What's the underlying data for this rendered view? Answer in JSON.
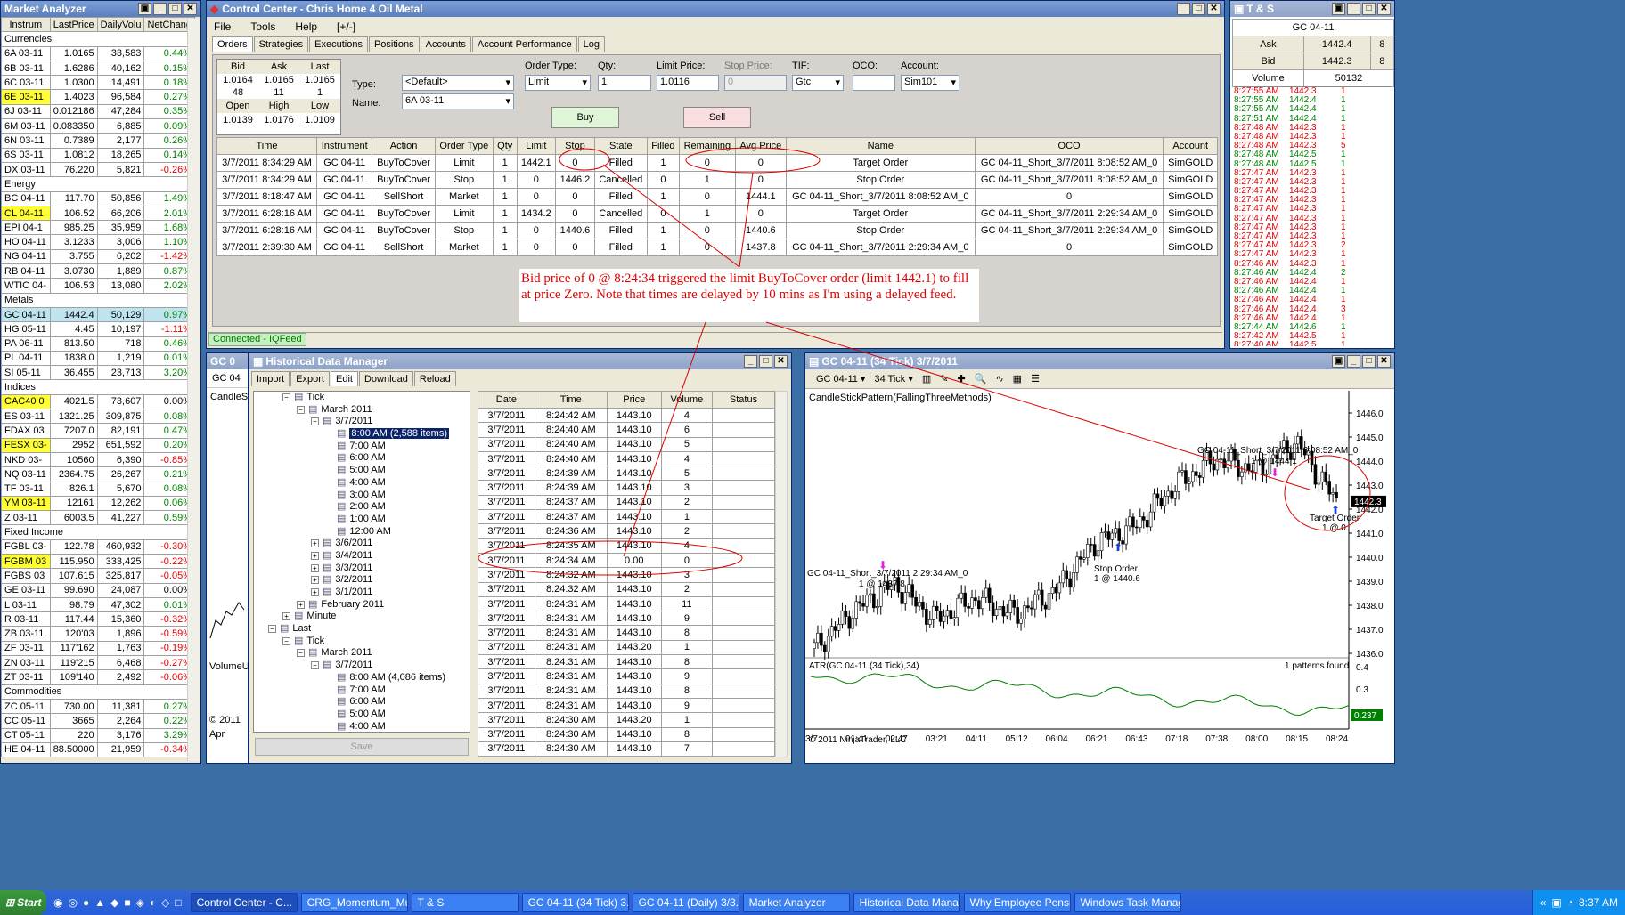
{
  "market_analyzer": {
    "title": "Market Analyzer",
    "columns": [
      "Instrum",
      "LastPrice",
      "DailyVolu",
      "NetChang"
    ],
    "rows": [
      {
        "section": "Currencies"
      },
      {
        "i": "6A 03-11",
        "p": "1.0165",
        "v": "33,583",
        "c": "0.44%",
        "d": "pos"
      },
      {
        "i": "6B 03-11",
        "p": "1.6286",
        "v": "40,162",
        "c": "0.15%",
        "d": "pos"
      },
      {
        "i": "6C 03-11",
        "p": "1.0300",
        "v": "14,491",
        "c": "0.18%",
        "d": "pos"
      },
      {
        "i": "6E 03-11",
        "p": "1.4023",
        "v": "96,584",
        "c": "0.27%",
        "d": "pos",
        "hl": "y"
      },
      {
        "i": "6J 03-11",
        "p": "0.012186",
        "v": "47,284",
        "c": "0.35%",
        "d": "pos"
      },
      {
        "i": "6M 03-11",
        "p": "0.083350",
        "v": "6,885",
        "c": "0.09%",
        "d": "pos"
      },
      {
        "i": "6N 03-11",
        "p": "0.7389",
        "v": "2,177",
        "c": "0.26%",
        "d": "pos"
      },
      {
        "i": "6S 03-11",
        "p": "1.0812",
        "v": "18,265",
        "c": "0.14%",
        "d": "pos"
      },
      {
        "i": "DX 03-11",
        "p": "76.220",
        "v": "5,821",
        "c": "-0.26%",
        "d": "neg"
      },
      {
        "section": "Energy"
      },
      {
        "i": "BC 04-11",
        "p": "117.70",
        "v": "50,856",
        "c": "1.49%",
        "d": "pos"
      },
      {
        "i": "CL 04-11",
        "p": "106.52",
        "v": "66,206",
        "c": "2.01%",
        "d": "pos",
        "hl": "y"
      },
      {
        "i": "EPI 04-1",
        "p": "985.25",
        "v": "35,959",
        "c": "1.68%",
        "d": "pos"
      },
      {
        "i": "HO 04-11",
        "p": "3.1233",
        "v": "3,006",
        "c": "1.10%",
        "d": "pos"
      },
      {
        "i": "NG 04-11",
        "p": "3.755",
        "v": "6,202",
        "c": "-1.42%",
        "d": "neg"
      },
      {
        "i": "RB 04-11",
        "p": "3.0730",
        "v": "1,889",
        "c": "0.87%",
        "d": "pos"
      },
      {
        "i": "WTIC 04-",
        "p": "106.53",
        "v": "13,080",
        "c": "2.02%",
        "d": "pos"
      },
      {
        "section": "Metals"
      },
      {
        "i": "GC 04-11",
        "p": "1442.4",
        "v": "50,129",
        "c": "0.97%",
        "d": "pos",
        "hl": "b"
      },
      {
        "i": "HG 05-11",
        "p": "4.45",
        "v": "10,197",
        "c": "-1.11%",
        "d": "neg"
      },
      {
        "i": "PA 06-11",
        "p": "813.50",
        "v": "718",
        "c": "0.46%",
        "d": "pos"
      },
      {
        "i": "PL 04-11",
        "p": "1838.0",
        "v": "1,219",
        "c": "0.01%",
        "d": "pos"
      },
      {
        "i": "SI 05-11",
        "p": "36.455",
        "v": "23,713",
        "c": "3.20%",
        "d": "pos"
      },
      {
        "section": "Indices"
      },
      {
        "i": "CAC40 0",
        "p": "4021.5",
        "v": "73,607",
        "c": "0.00%",
        "d": "",
        "hl": "y"
      },
      {
        "i": "ES 03-11",
        "p": "1321.25",
        "v": "309,875",
        "c": "0.08%",
        "d": "pos"
      },
      {
        "i": "FDAX 03",
        "p": "7207.0",
        "v": "82,191",
        "c": "0.47%",
        "d": "pos"
      },
      {
        "i": "FESX 03-",
        "p": "2952",
        "v": "651,592",
        "c": "0.20%",
        "d": "pos",
        "hl": "y"
      },
      {
        "i": "NKD 03-",
        "p": "10560",
        "v": "6,390",
        "c": "-0.85%",
        "d": "neg"
      },
      {
        "i": "NQ 03-11",
        "p": "2364.75",
        "v": "26,267",
        "c": "0.21%",
        "d": "pos"
      },
      {
        "i": "TF 03-11",
        "p": "826.1",
        "v": "5,670",
        "c": "0.08%",
        "d": "pos"
      },
      {
        "i": "YM 03-11",
        "p": "12161",
        "v": "12,262",
        "c": "0.06%",
        "d": "pos",
        "hl": "y"
      },
      {
        "i": "Z 03-11",
        "p": "6003.5",
        "v": "41,227",
        "c": "0.59%",
        "d": "pos"
      },
      {
        "section": "Fixed Income"
      },
      {
        "i": "FGBL 03-",
        "p": "122.78",
        "v": "460,932",
        "c": "-0.30%",
        "d": "neg"
      },
      {
        "i": "FGBM 03",
        "p": "115.950",
        "v": "333,425",
        "c": "-0.22%",
        "d": "neg",
        "hl": "y"
      },
      {
        "i": "FGBS 03",
        "p": "107.615",
        "v": "325,817",
        "c": "-0.05%",
        "d": "neg"
      },
      {
        "i": "GE 03-11",
        "p": "99.690",
        "v": "24,087",
        "c": "0.00%",
        "d": ""
      },
      {
        "i": "L 03-11",
        "p": "98.79",
        "v": "47,302",
        "c": "0.01%",
        "d": "pos"
      },
      {
        "i": "R 03-11",
        "p": "117.44",
        "v": "15,360",
        "c": "-0.32%",
        "d": "neg"
      },
      {
        "i": "ZB 03-11",
        "p": "120'03",
        "v": "1,896",
        "c": "-0.59%",
        "d": "neg"
      },
      {
        "i": "ZF 03-11",
        "p": "117'162",
        "v": "1,763",
        "c": "-0.19%",
        "d": "neg"
      },
      {
        "i": "ZN 03-11",
        "p": "119'215",
        "v": "6,468",
        "c": "-0.27%",
        "d": "neg"
      },
      {
        "i": "ZT 03-11",
        "p": "109'140",
        "v": "2,492",
        "c": "-0.06%",
        "d": "neg"
      },
      {
        "section": "Commodities"
      },
      {
        "i": "ZC 05-11",
        "p": "730.00",
        "v": "11,381",
        "c": "0.27%",
        "d": "pos"
      },
      {
        "i": "CC 05-11",
        "p": "3665",
        "v": "2,264",
        "c": "0.22%",
        "d": "pos"
      },
      {
        "i": "CT 05-11",
        "p": "220",
        "v": "3,176",
        "c": "3.29%",
        "d": "pos"
      },
      {
        "i": "HE 04-11",
        "p": "88.50000",
        "v": "21,959",
        "c": "-0.34%",
        "d": "neg"
      }
    ]
  },
  "control_center": {
    "title": "Control Center - Chris Home 4 Oil Metal",
    "menu": [
      "File",
      "Tools",
      "Help",
      "[+/-]"
    ],
    "tabs": [
      "Orders",
      "Strategies",
      "Executions",
      "Positions",
      "Accounts",
      "Account Performance",
      "Log"
    ],
    "quote": {
      "bid_h": "Bid",
      "ask_h": "Ask",
      "last_h": "Last",
      "bid": "1.0164",
      "ask": "1.0165",
      "last": "1.0165",
      "bid_sz": "48",
      "ask_sz": "11",
      "last_sz": "1",
      "open_h": "Open",
      "high_h": "High",
      "low_h": "Low",
      "open": "1.0139",
      "high": "1.0176",
      "low": "1.0109"
    },
    "form": {
      "type_label": "Type:",
      "type": "<Default>",
      "name_label": "Name:",
      "name": "6A 03-11",
      "order_type_label": "Order Type:",
      "order_type": "Limit",
      "qty_label": "Qty:",
      "qty": "1",
      "limit_label": "Limit Price:",
      "limit": "1.0116",
      "stop_label": "Stop Price:",
      "stop": "0",
      "tif_label": "TIF:",
      "tif": "Gtc",
      "oco_label": "OCO:",
      "oco": "",
      "account_label": "Account:",
      "account": "Sim101",
      "buy": "Buy",
      "sell": "Sell"
    },
    "orders_columns": [
      "Time",
      "Instrument",
      "Action",
      "Order Type",
      "Qty",
      "Limit",
      "Stop",
      "State",
      "Filled",
      "Remaining",
      "Avg Price",
      "Name",
      "OCO",
      "Account"
    ],
    "orders": [
      [
        "3/7/2011 8:34:29 AM",
        "GC 04-11",
        "BuyToCover",
        "Limit",
        "1",
        "1442.1",
        "0",
        "Filled",
        "1",
        "0",
        "0",
        "Target Order",
        "GC 04-11_Short_3/7/2011 8:08:52 AM_0",
        "SimGOLD"
      ],
      [
        "3/7/2011 8:34:29 AM",
        "GC 04-11",
        "BuyToCover",
        "Stop",
        "1",
        "0",
        "1446.2",
        "Cancelled",
        "0",
        "1",
        "0",
        "Stop Order",
        "GC 04-11_Short_3/7/2011 8:08:52 AM_0",
        "SimGOLD"
      ],
      [
        "3/7/2011 8:18:47 AM",
        "GC 04-11",
        "SellShort",
        "Market",
        "1",
        "0",
        "0",
        "Filled",
        "1",
        "0",
        "1444.1",
        "GC 04-11_Short_3/7/2011 8:08:52 AM_0",
        "0",
        "SimGOLD"
      ],
      [
        "3/7/2011 6:28:16 AM",
        "GC 04-11",
        "BuyToCover",
        "Limit",
        "1",
        "1434.2",
        "0",
        "Cancelled",
        "0",
        "1",
        "0",
        "Target Order",
        "GC 04-11_Short_3/7/2011 2:29:34 AM_0",
        "SimGOLD"
      ],
      [
        "3/7/2011 6:28:16 AM",
        "GC 04-11",
        "BuyToCover",
        "Stop",
        "1",
        "0",
        "1440.6",
        "Filled",
        "1",
        "0",
        "1440.6",
        "Stop Order",
        "GC 04-11_Short_3/7/2011 2:29:34 AM_0",
        "SimGOLD"
      ],
      [
        "3/7/2011 2:39:30 AM",
        "GC 04-11",
        "SellShort",
        "Market",
        "1",
        "0",
        "0",
        "Filled",
        "1",
        "0",
        "1437.8",
        "GC 04-11_Short_3/7/2011 2:29:34 AM_0",
        "0",
        "SimGOLD"
      ]
    ],
    "annotation": "Bid price of 0 @ 8:24:34 triggered the limit BuyToCover order (limit 1442.1) to fill at price Zero.  Note that times are delayed by 10 mins as I'm using a delayed feed.",
    "status": "Connected - IQFeed"
  },
  "ts": {
    "title": "T & S",
    "instrument": "GC 04-11",
    "ask_label": "Ask",
    "ask": "1442.4",
    "ask_sz": "8",
    "bid_label": "Bid",
    "bid": "1442.3",
    "bid_sz": "8",
    "volume_label": "Volume",
    "volume": "50132",
    "rows": [
      [
        "8:27:55 AM",
        "1442.3",
        "1",
        "r"
      ],
      [
        "8:27:55 AM",
        "1442.4",
        "1",
        "g"
      ],
      [
        "8:27:55 AM",
        "1442.4",
        "1",
        "g"
      ],
      [
        "8:27:51 AM",
        "1442.4",
        "1",
        "g"
      ],
      [
        "8:27:48 AM",
        "1442.3",
        "1",
        "r"
      ],
      [
        "8:27:48 AM",
        "1442.3",
        "1",
        "r"
      ],
      [
        "8:27:48 AM",
        "1442.3",
        "5",
        "r"
      ],
      [
        "8:27:48 AM",
        "1442.5",
        "1",
        "g"
      ],
      [
        "8:27:48 AM",
        "1442.5",
        "1",
        "g"
      ],
      [
        "8:27:47 AM",
        "1442.3",
        "1",
        "r"
      ],
      [
        "8:27:47 AM",
        "1442.3",
        "1",
        "r"
      ],
      [
        "8:27:47 AM",
        "1442.3",
        "1",
        "r"
      ],
      [
        "8:27:47 AM",
        "1442.3",
        "1",
        "r"
      ],
      [
        "8:27:47 AM",
        "1442.3",
        "1",
        "r"
      ],
      [
        "8:27:47 AM",
        "1442.3",
        "1",
        "r"
      ],
      [
        "8:27:47 AM",
        "1442.3",
        "1",
        "r"
      ],
      [
        "8:27:47 AM",
        "1442.3",
        "1",
        "r"
      ],
      [
        "8:27:47 AM",
        "1442.3",
        "2",
        "r"
      ],
      [
        "8:27:47 AM",
        "1442.3",
        "1",
        "r"
      ],
      [
        "8:27:46 AM",
        "1442.3",
        "1",
        "r"
      ],
      [
        "8:27:46 AM",
        "1442.4",
        "2",
        "g"
      ],
      [
        "8:27:46 AM",
        "1442.4",
        "1",
        "r"
      ],
      [
        "8:27:46 AM",
        "1442.4",
        "1",
        "g"
      ],
      [
        "8:27:46 AM",
        "1442.4",
        "1",
        "r"
      ],
      [
        "8:27:46 AM",
        "1442.4",
        "3",
        "r"
      ],
      [
        "8:27:46 AM",
        "1442.4",
        "1",
        "r"
      ],
      [
        "8:27:44 AM",
        "1442.6",
        "1",
        "g"
      ],
      [
        "8:27:42 AM",
        "1442.5",
        "1",
        "r"
      ],
      [
        "8:27:40 AM",
        "1442.5",
        "1",
        "r"
      ]
    ]
  },
  "hdm": {
    "title": "Historical Data Manager",
    "behind_title": "GC 0",
    "behind_tab": "GC 04",
    "behind_label1": "CandleSt",
    "behind_label2": "VolumeU",
    "behind_label3": "Apr",
    "behind_label4": "© 2011",
    "tabs": [
      "Import",
      "Export",
      "Edit",
      "Download",
      "Reload"
    ],
    "tree": [
      {
        "d": 2,
        "t": "Tick",
        "b": "−"
      },
      {
        "d": 3,
        "t": "March 2011",
        "b": "−"
      },
      {
        "d": 4,
        "t": "3/7/2011",
        "b": "−"
      },
      {
        "d": 5,
        "t": "8:00 AM (2,588 items)",
        "sel": true
      },
      {
        "d": 5,
        "t": "7:00 AM"
      },
      {
        "d": 5,
        "t": "6:00 AM"
      },
      {
        "d": 5,
        "t": "5:00 AM"
      },
      {
        "d": 5,
        "t": "4:00 AM"
      },
      {
        "d": 5,
        "t": "3:00 AM"
      },
      {
        "d": 5,
        "t": "2:00 AM"
      },
      {
        "d": 5,
        "t": "1:00 AM"
      },
      {
        "d": 5,
        "t": "12:00 AM"
      },
      {
        "d": 4,
        "t": "3/6/2011",
        "b": "+"
      },
      {
        "d": 4,
        "t": "3/4/2011",
        "b": "+"
      },
      {
        "d": 4,
        "t": "3/3/2011",
        "b": "+"
      },
      {
        "d": 4,
        "t": "3/2/2011",
        "b": "+"
      },
      {
        "d": 4,
        "t": "3/1/2011",
        "b": "+"
      },
      {
        "d": 3,
        "t": "February 2011",
        "b": "+"
      },
      {
        "d": 2,
        "t": "Minute",
        "b": "+"
      },
      {
        "d": 1,
        "t": "Last",
        "b": "−"
      },
      {
        "d": 2,
        "t": "Tick",
        "b": "−"
      },
      {
        "d": 3,
        "t": "March 2011",
        "b": "−"
      },
      {
        "d": 4,
        "t": "3/7/2011",
        "b": "−"
      },
      {
        "d": 5,
        "t": "8:00 AM (4,086 items)"
      },
      {
        "d": 5,
        "t": "7:00 AM"
      },
      {
        "d": 5,
        "t": "6:00 AM"
      },
      {
        "d": 5,
        "t": "5:00 AM"
      },
      {
        "d": 5,
        "t": "4:00 AM"
      }
    ],
    "save": "Save",
    "columns": [
      "Date",
      "Time",
      "Price",
      "Volume",
      "Status"
    ],
    "rows": [
      [
        "3/7/2011",
        "8:24:42 AM",
        "1443.10",
        "4"
      ],
      [
        "3/7/2011",
        "8:24:40 AM",
        "1443.10",
        "6"
      ],
      [
        "3/7/2011",
        "8:24:40 AM",
        "1443.10",
        "5"
      ],
      [
        "3/7/2011",
        "8:24:40 AM",
        "1443.10",
        "4"
      ],
      [
        "3/7/2011",
        "8:24:39 AM",
        "1443.10",
        "5"
      ],
      [
        "3/7/2011",
        "8:24:39 AM",
        "1443.10",
        "3"
      ],
      [
        "3/7/2011",
        "8:24:37 AM",
        "1443.10",
        "2"
      ],
      [
        "3/7/2011",
        "8:24:37 AM",
        "1443.10",
        "1"
      ],
      [
        "3/7/2011",
        "8:24:36 AM",
        "1443.10",
        "2"
      ],
      [
        "3/7/2011",
        "8:24:35 AM",
        "1443.10",
        "4"
      ],
      [
        "3/7/2011",
        "8:24:34 AM",
        "0.00",
        "0"
      ],
      [
        "3/7/2011",
        "8:24:32 AM",
        "1443.10",
        "3"
      ],
      [
        "3/7/2011",
        "8:24:32 AM",
        "1443.10",
        "2"
      ],
      [
        "3/7/2011",
        "8:24:31 AM",
        "1443.10",
        "11"
      ],
      [
        "3/7/2011",
        "8:24:31 AM",
        "1443.10",
        "9"
      ],
      [
        "3/7/2011",
        "8:24:31 AM",
        "1443.10",
        "8"
      ],
      [
        "3/7/2011",
        "8:24:31 AM",
        "1443.20",
        "1"
      ],
      [
        "3/7/2011",
        "8:24:31 AM",
        "1443.10",
        "8"
      ],
      [
        "3/7/2011",
        "8:24:31 AM",
        "1443.10",
        "9"
      ],
      [
        "3/7/2011",
        "8:24:31 AM",
        "1443.10",
        "8"
      ],
      [
        "3/7/2011",
        "8:24:31 AM",
        "1443.10",
        "9"
      ],
      [
        "3/7/2011",
        "8:24:30 AM",
        "1443.20",
        "1"
      ],
      [
        "3/7/2011",
        "8:24:30 AM",
        "1443.10",
        "8"
      ],
      [
        "3/7/2011",
        "8:24:30 AM",
        "1443.10",
        "7"
      ]
    ]
  },
  "chart": {
    "title": "GC 04-11 (34 Tick)  3/7/2011",
    "instrument": "GC 04-11",
    "period": "34 Tick",
    "indicator": "CandleStickPattern(FallingThreeMethods)",
    "atr_label": "ATR(GC 04-11 (34 Tick),34)",
    "patterns_found": "1 patterns found",
    "copyright": "© 2011 NinjaTrader, LLC",
    "short1": "GC 04-11_Short_3/7/2011 2:29:34 AM_0",
    "short1_sub": "1 @ 1437.8",
    "short2": "GC 04-11_Short_3/7/2011 8:08:52 AM_0",
    "short2_sub": "1 @ 1444.1",
    "stop_label": "Stop Order",
    "stop_sub": "1 @ 1440.6",
    "target_label": "Target Order",
    "target_sub": "1 @ 0",
    "last_price": "1442.3",
    "atr_last": "0.237",
    "y_ticks": [
      "1446.0",
      "1445.0",
      "1444.0",
      "1443.0",
      "1442.0",
      "1441.0",
      "1440.0",
      "1439.0",
      "1438.0",
      "1437.0",
      "1436.0"
    ],
    "atr_ticks": [
      "0.4",
      "0.3",
      "0.2"
    ],
    "x_ticks": [
      "3/7",
      "01:41",
      "02:47",
      "03:21",
      "04:11",
      "05:12",
      "06:04",
      "06:21",
      "06:43",
      "07:18",
      "07:38",
      "08:00",
      "08:15",
      "08:24"
    ]
  },
  "chart_data": {
    "type": "line",
    "title": "GC 04-11 (34 Tick)  3/7/2011",
    "x": [
      "3/7",
      "01:41",
      "02:47",
      "03:21",
      "04:11",
      "05:12",
      "06:04",
      "06:21",
      "06:43",
      "07:18",
      "07:38",
      "08:00",
      "08:15",
      "08:24"
    ],
    "series": [
      {
        "name": "",
        "values": [
          1436.2,
          1437.8,
          1438.9,
          1437.4,
          1438.3,
          1437.6,
          1438.6,
          1440.6,
          1441.3,
          1443.0,
          1444.1,
          1443.6,
          1444.8,
          1442.3
        ]
      }
    ],
    "ylim": [
      1436,
      1446
    ],
    "xlabel": "",
    "ylabel": ""
  },
  "taskbar": {
    "start": "Start",
    "items": [
      "Control Center - C...",
      "CRG_Momentum_Mul...",
      "T & S",
      "GC 04-11 (34 Tick)  3...",
      "GC 04-11 (Daily)  3/3...",
      "Market Analyzer",
      "Historical Data Manager",
      "Why Employee Pensi...",
      "Windows Task Manager"
    ],
    "clock": "8:37 AM"
  }
}
